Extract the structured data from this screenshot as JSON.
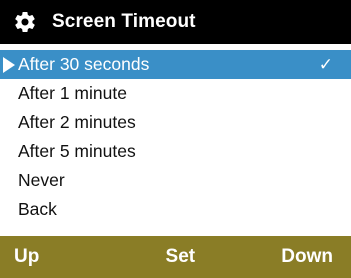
{
  "header": {
    "title": "Screen Timeout",
    "icon": "gear-icon"
  },
  "menu": {
    "selected_index": 0,
    "check_mark": "✓",
    "items": [
      {
        "label": "After 30 seconds",
        "checked": true
      },
      {
        "label": "After 1 minute",
        "checked": false
      },
      {
        "label": "After 2 minutes",
        "checked": false
      },
      {
        "label": "After 5 minutes",
        "checked": false
      },
      {
        "label": "Never",
        "checked": false
      },
      {
        "label": "Back",
        "checked": false
      }
    ]
  },
  "softkeys": {
    "left": "Up",
    "center": "Set",
    "right": "Down"
  },
  "colors": {
    "title_bar": "#000000",
    "highlight": "#3a8fc7",
    "softkey_bar": "#8a7d26",
    "text": "#111111",
    "highlight_text": "#ffffff"
  }
}
